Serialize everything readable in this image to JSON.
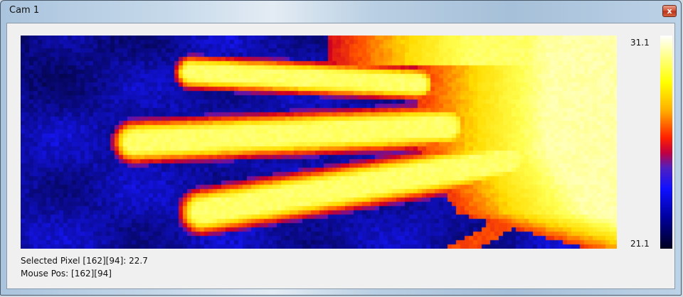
{
  "window": {
    "title": "Cam 1",
    "close_glyph": "x"
  },
  "scale": {
    "max": "31.1",
    "min": "21.1"
  },
  "status": {
    "selected_pixel": "Selected Pixel [162][94]:  22.7",
    "mouse_pos": "Mouse Pos: [162][94]"
  },
  "icons": {
    "close": "close-icon"
  },
  "colors": {
    "cold": "#000020",
    "cool": "#1010ff",
    "warm": "#ff2000",
    "hot": "#ffff00",
    "hottest": "#ffffff"
  }
}
